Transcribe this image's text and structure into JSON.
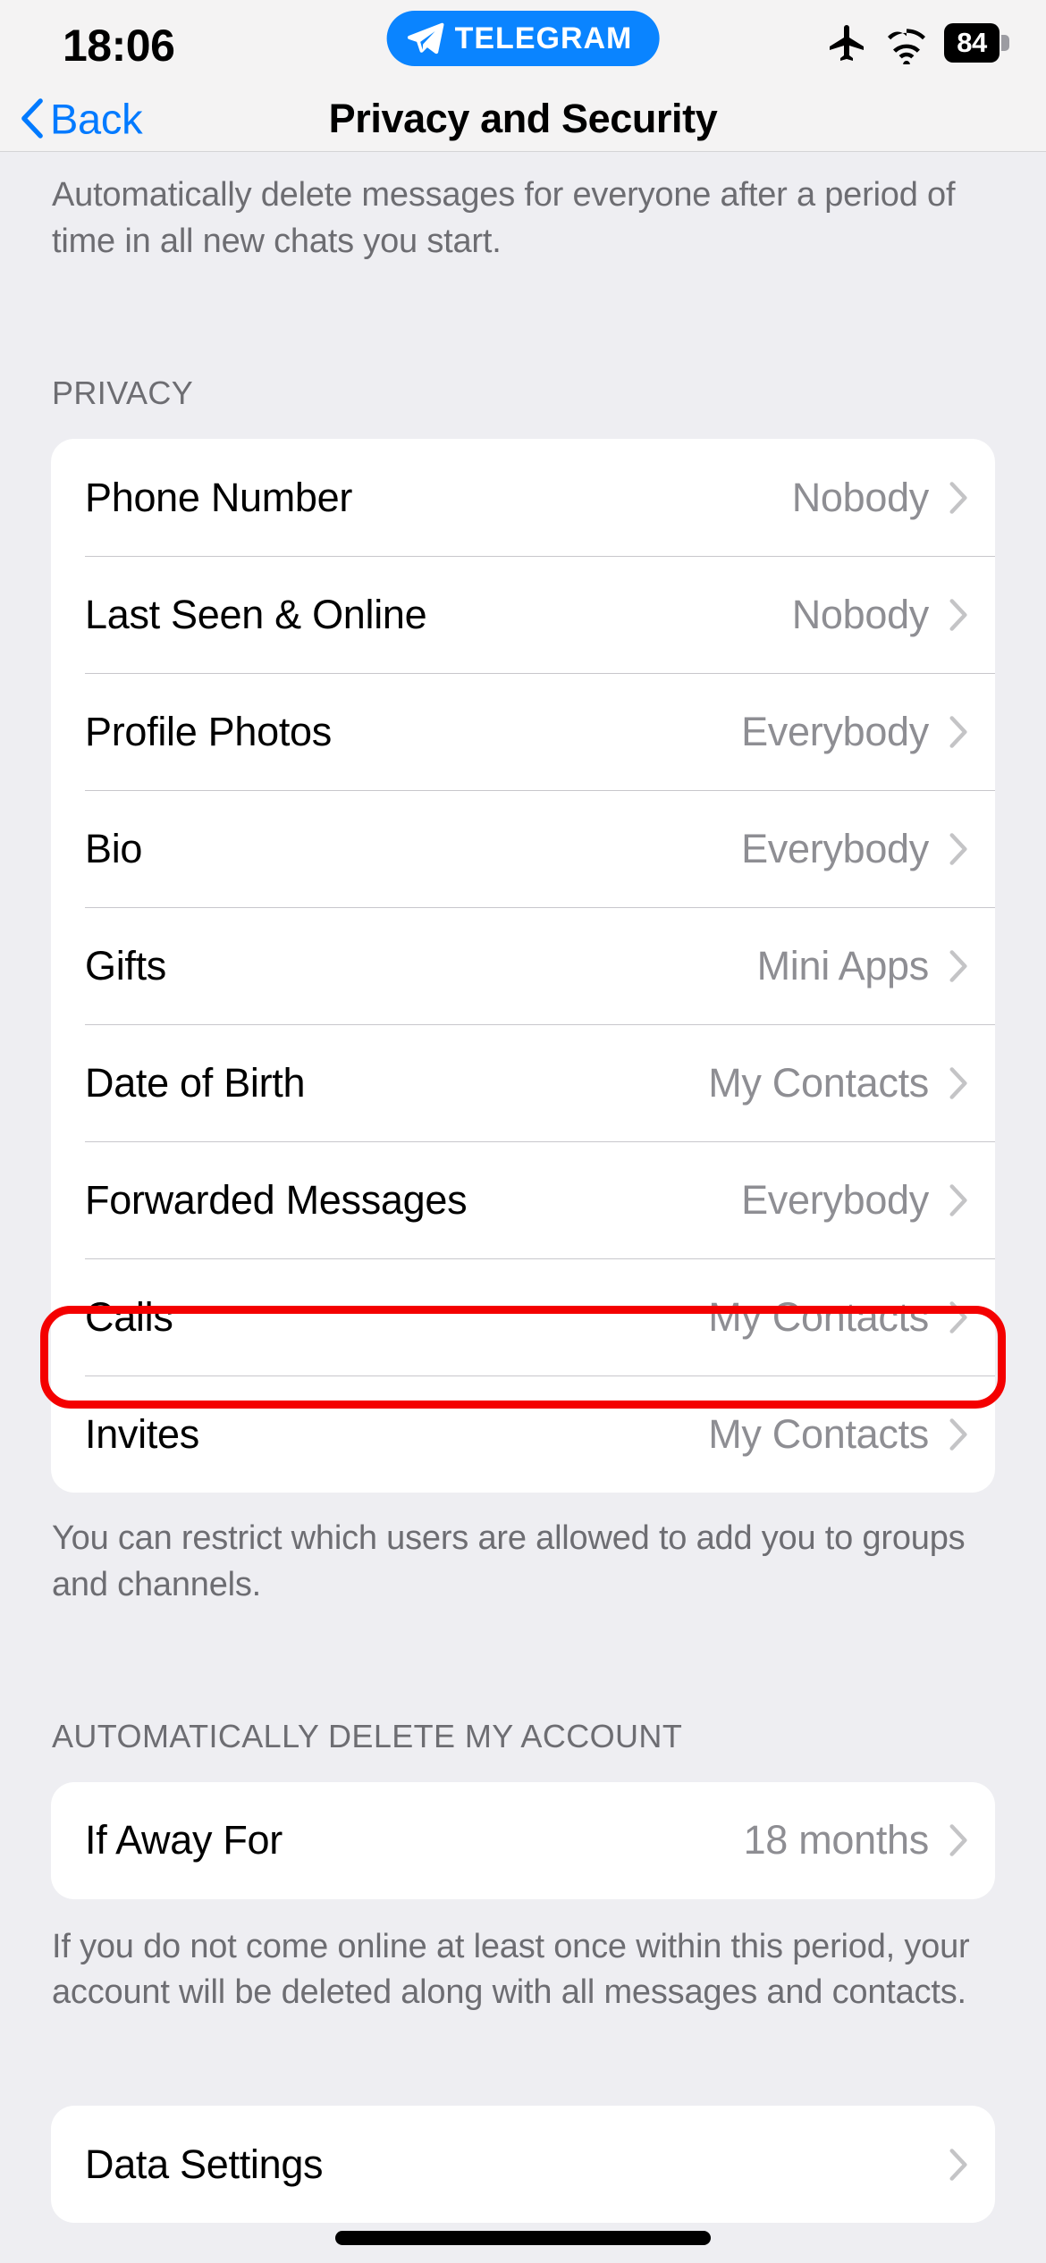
{
  "status_bar": {
    "time": "18:06",
    "pill_label": "TELEGRAM",
    "pill_icon": "telegram-plane-icon",
    "pill_color": "#0a84ff",
    "icons": [
      "airplane-mode-icon",
      "wifi-icon"
    ],
    "battery_level": "84"
  },
  "nav": {
    "back_label": "Back",
    "back_icon": "chevron-left-icon",
    "title": "Privacy and Security",
    "tint_color": "#007aff"
  },
  "intro_footnote": "Automatically delete messages for everyone after a period of time in all new chats you start.",
  "privacy": {
    "header": "PRIVACY",
    "rows": [
      {
        "label": "Phone Number",
        "value": "Nobody"
      },
      {
        "label": "Last Seen & Online",
        "value": "Nobody"
      },
      {
        "label": "Profile Photos",
        "value": "Everybody"
      },
      {
        "label": "Bio",
        "value": "Everybody"
      },
      {
        "label": "Gifts",
        "value": "Mini Apps"
      },
      {
        "label": "Date of Birth",
        "value": "My Contacts"
      },
      {
        "label": "Forwarded Messages",
        "value": "Everybody"
      },
      {
        "label": "Calls",
        "value": "My Contacts"
      },
      {
        "label": "Invites",
        "value": "My Contacts"
      }
    ],
    "footnote": "You can restrict which users are allowed to add you to groups and channels."
  },
  "highlight": {
    "target_row_label": "Invites",
    "color": "#f40000"
  },
  "auto_delete": {
    "header": "AUTOMATICALLY DELETE MY ACCOUNT",
    "rows": [
      {
        "label": "If Away For",
        "value": "18 months"
      }
    ],
    "footnote": "If you do not come online at least once within this period, your account will be deleted along with all messages and contacts."
  },
  "data_section": {
    "rows": [
      {
        "label": "Data Settings",
        "value": ""
      }
    ]
  }
}
